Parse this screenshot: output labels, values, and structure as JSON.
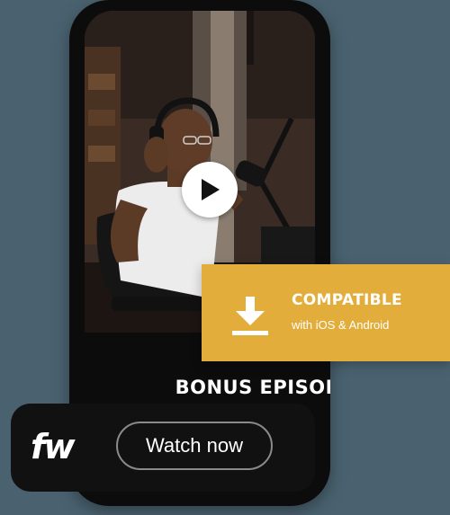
{
  "video": {
    "play_icon": "play-icon"
  },
  "badge": {
    "icon": "download-icon",
    "title": "COMPATIBLE",
    "subtitle": "with iOS & Android",
    "color": "#e2ad3b"
  },
  "episode": {
    "title": "BONUS EPISODE"
  },
  "cta": {
    "logo_text": "fw",
    "watch_label": "Watch now"
  },
  "colors": {
    "background": "#4a6270",
    "phone": "#0c0c0c",
    "accent": "#e2ad3b"
  }
}
